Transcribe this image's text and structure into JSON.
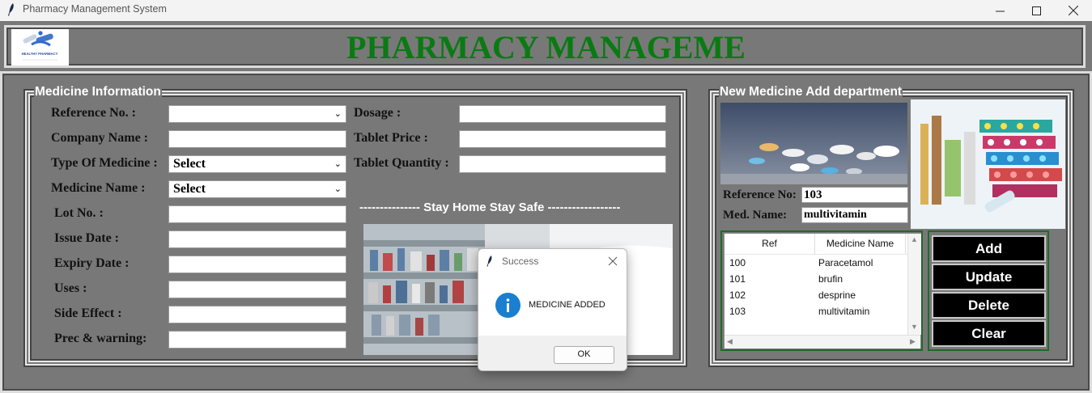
{
  "window": {
    "title": "Pharmacy Management System"
  },
  "header": {
    "title": "PHARMACY MANAGEME",
    "logo_text": "HEALTHY PHARMACY"
  },
  "medicine_info": {
    "title": "Medicine Information",
    "fields": {
      "reference": {
        "label": "Reference No. :",
        "value": ""
      },
      "company": {
        "label": "Company Name  :",
        "value": ""
      },
      "type": {
        "label": "Type Of Medicine :",
        "value": "Select"
      },
      "name": {
        "label": "Medicine Name :",
        "value": "Select"
      },
      "lot": {
        "label": "Lot No. :",
        "value": ""
      },
      "issue": {
        "label": "Issue Date :",
        "value": ""
      },
      "expiry": {
        "label": "Expiry Date :",
        "value": ""
      },
      "uses": {
        "label": "Uses :",
        "value": ""
      },
      "side": {
        "label": "Side Effect :",
        "value": ""
      },
      "prec": {
        "label": "Prec & warning:",
        "value": ""
      },
      "dosage": {
        "label": "Dosage :",
        "value": ""
      },
      "price": {
        "label": "Tablet Price :",
        "value": ""
      },
      "quantity": {
        "label": "Tablet Quantity :",
        "value": ""
      }
    },
    "banner": "--------------- Stay Home Stay Safe ------------------"
  },
  "new_medicine": {
    "title": "New Medicine Add department",
    "reference_label": "Reference No:",
    "reference_value": "103",
    "name_label": "Med. Name:",
    "name_value": "multivitamin"
  },
  "table": {
    "columns": [
      "Ref",
      "Medicine Name"
    ],
    "rows": [
      {
        "ref": "100",
        "name": "Paracetamol"
      },
      {
        "ref": "101",
        "name": "brufin"
      },
      {
        "ref": "102",
        "name": "desprine"
      },
      {
        "ref": "103",
        "name": "multivitamin"
      }
    ]
  },
  "buttons": {
    "add": "Add",
    "update": "Update",
    "delete": "Delete",
    "clear": "Clear"
  },
  "dialog": {
    "title": "Success",
    "message": "MEDICINE ADDED",
    "ok": "OK"
  },
  "colors": {
    "title_green": "#0a7a12",
    "background": "#787878",
    "button_bg": "#000000",
    "info_blue": "#1a7fd0"
  }
}
